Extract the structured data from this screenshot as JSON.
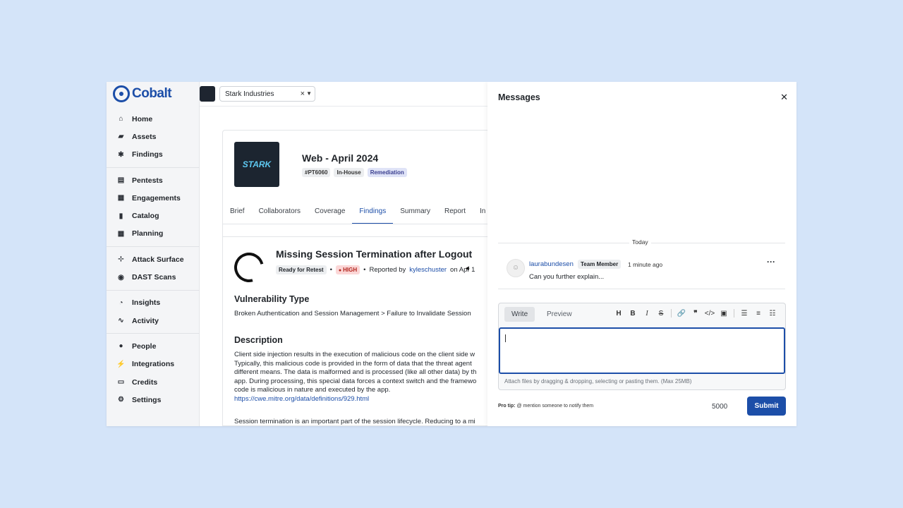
{
  "brand": {
    "name": "Cobalt",
    "color": "#1c4ea8"
  },
  "org": {
    "name": "Stark Industries",
    "logo_text": "STARK"
  },
  "sidebar": {
    "groups": [
      [
        {
          "label": "Home",
          "icon": "home-icon"
        },
        {
          "label": "Assets",
          "icon": "folder-icon"
        },
        {
          "label": "Findings",
          "icon": "bug-icon"
        }
      ],
      [
        {
          "label": "Pentests",
          "icon": "document-icon"
        },
        {
          "label": "Engagements",
          "icon": "briefcase-icon"
        },
        {
          "label": "Catalog",
          "icon": "book-icon"
        },
        {
          "label": "Planning",
          "icon": "calendar-icon"
        }
      ],
      [
        {
          "label": "Attack Surface",
          "icon": "network-icon"
        },
        {
          "label": "DAST Scans",
          "icon": "radar-icon"
        }
      ],
      [
        {
          "label": "Insights",
          "icon": "pie-chart-icon"
        },
        {
          "label": "Activity",
          "icon": "pulse-icon"
        }
      ],
      [
        {
          "label": "People",
          "icon": "users-icon"
        },
        {
          "label": "Integrations",
          "icon": "plug-icon"
        },
        {
          "label": "Credits",
          "icon": "credit-card-icon"
        },
        {
          "label": "Settings",
          "icon": "gear-icon"
        }
      ]
    ]
  },
  "pentest": {
    "title": "Web - April 2024",
    "id": "#PT6060",
    "type": "In-House",
    "state": "Remediation",
    "tabs": [
      "Brief",
      "Collaborators",
      "Coverage",
      "Findings",
      "Summary",
      "Report",
      "In"
    ],
    "active_tab": "Findings"
  },
  "finding": {
    "title": "Missing Session Termination after Logout",
    "status": "Ready for Retest",
    "severity": "HIGH",
    "reported_by_prefix": "Reported by",
    "reporter": "kyleschuster",
    "date_prefix": "on Apr 1",
    "vuln_type_heading": "Vulnerability Type",
    "vuln_type": "Broken Authentication and Session Management > Failure to Invalidate Session",
    "description_heading": "Description",
    "description_lines": [
      "Client side injection results in the execution of malicious code on the client side w",
      "Typically, this malicious code is provided in the form of data that the threat agent",
      "different means. The data is malformed and is processed (like all other data) by th",
      "app. During processing, this special data forces a context switch and the framewo",
      "code is malicious in nature and executed by the app."
    ],
    "description_link": "https://cwe.mitre.org/data/definitions/929.html",
    "trailing_text": "Session termination is an important part of the session lifecycle. Reducing to a mi"
  },
  "messages": {
    "title": "Messages",
    "day_label": "Today",
    "items": [
      {
        "user": "laurabundesen",
        "role": "Team Member",
        "time": "1 minute ago",
        "text": "Can you further explain..."
      }
    ],
    "editor": {
      "write_tab": "Write",
      "preview_tab": "Preview",
      "attach_hint": "Attach files by dragging & dropping, selecting or pasting them. (Max 25MB)",
      "pro_tip_label": "Pro tip:",
      "pro_tip_text": "@ mention someone to notify them",
      "char_count": "5000",
      "submit_label": "Submit"
    }
  }
}
